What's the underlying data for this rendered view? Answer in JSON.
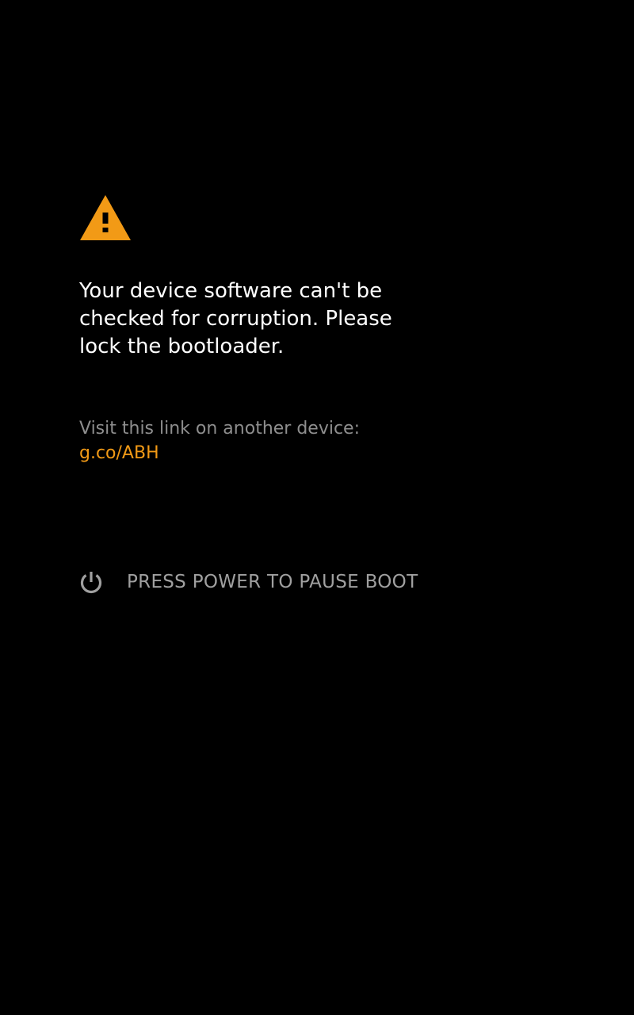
{
  "colors": {
    "background": "#000000",
    "message_text": "#ffffff",
    "secondary_text": "#8e8e8e",
    "accent": "#f29a16",
    "power_text": "#a0a0a0"
  },
  "warning": {
    "icon": "warning-triangle-icon",
    "message_lines": [
      "Your device software can't be",
      "checked for corruption. Please",
      "lock the bootloader."
    ]
  },
  "visit": {
    "label": "Visit this link on another device:",
    "link": "g.co/ABH"
  },
  "power": {
    "icon": "power-icon",
    "label": "PRESS POWER TO PAUSE BOOT"
  }
}
